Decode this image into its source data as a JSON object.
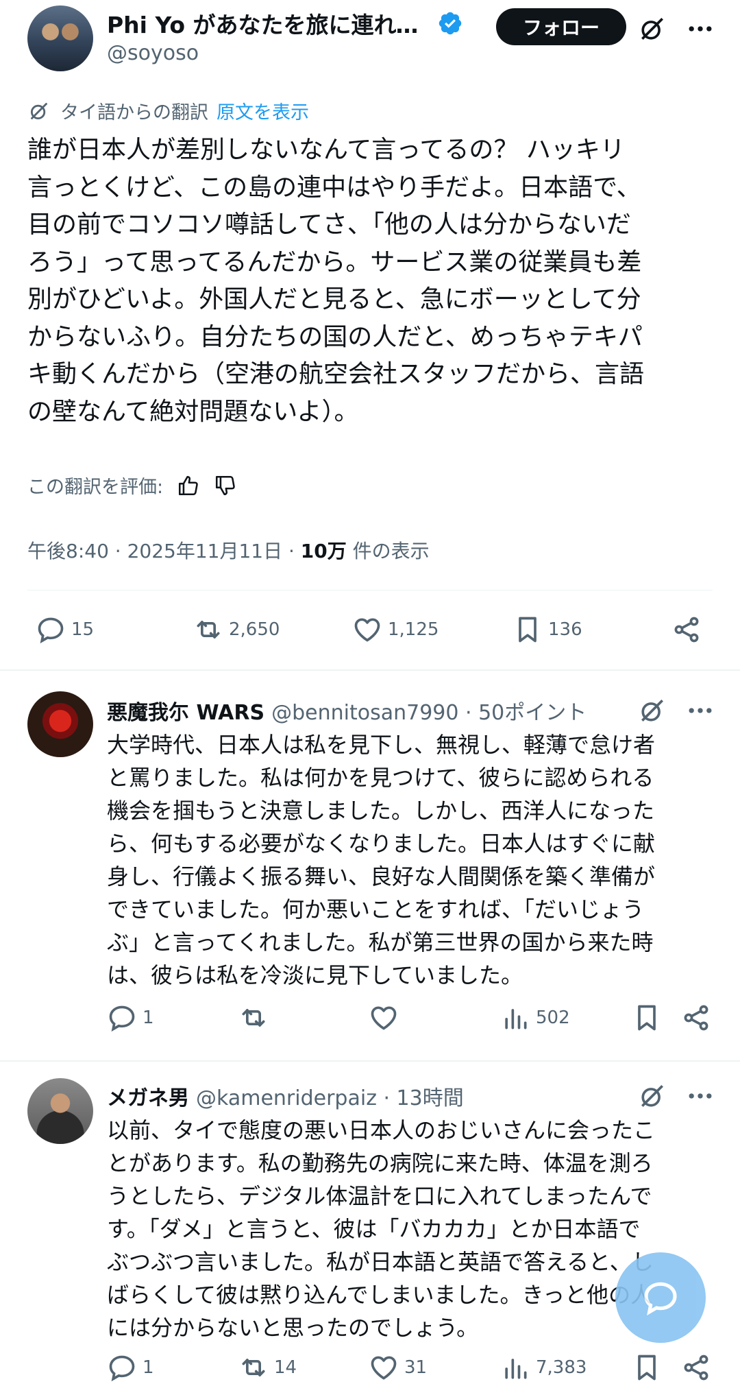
{
  "post": {
    "display_name": "Phi Yo があなたを旅に連れて…",
    "handle": "@soyoso",
    "follow_label": "フォロー",
    "translation_note": "タイ語からの翻訳",
    "show_original": "原文を表示",
    "body_lines": [
      "誰が日本人が差別しないなんて言ってるの？ ハッキリ",
      "言っとくけど、この島の連中はやり手だよ。日本語で、",
      "目の前でコソコソ噂話してさ、「他の人は分からないだ",
      "ろう」って思ってるんだから。サービス業の従業員も差",
      "別がひどいよ。外国人だと見ると、急にボーッとして分",
      "からないふり。自分たちの国の人だと、めっちゃテキパ",
      "キ動くんだから（空港の航空会社スタッフだから、言語",
      "の壁なんて絶対問題ないよ）。"
    ],
    "rate_label": "この翻訳を評価:",
    "time": "午後8:40 · 2025年11月11日 · ",
    "views_count": "10万",
    "views_label": " 件の表示",
    "replies": "15",
    "reposts": "2,650",
    "likes": "1,125",
    "bookmarks": "136"
  },
  "replies": [
    {
      "name": "悪魔我尓 WARS",
      "handle": "@bennitosan7990 · 50ポイント",
      "body_lines": [
        "大学時代、日本人は私を見下し、無視し、軽薄で怠け者",
        "と罵りました。私は何かを見つけて、彼らに認められる",
        "機会を掴もうと決意しました。しかし、西洋人になった",
        "ら、何もする必要がなくなりました。日本人はすぐに献",
        "身し、行儀よく振る舞い、良好な人間関係を築く準備が",
        "できていました。何か悪いことをすれば、「だいじょう",
        "ぶ」と言ってくれました。私が第三世界の国から来た時",
        "は、彼らは私を冷淡に見下していました。"
      ],
      "replies": "1",
      "reposts": "",
      "likes": "",
      "views": "502"
    },
    {
      "name": "メガネ男",
      "handle": "@kamenriderpaiz · 13時間",
      "body_lines": [
        "以前、タイで態度の悪い日本人のおじいさんに会ったこ",
        "とがあります。私の勤務先の病院に来た時、体温を測ろ",
        "うとしたら、デジタル体温計を口に入れてしまったんで",
        "す。「ダメ」と言うと、彼は「バカカカ」とか日本語で",
        "ぶつぶつ言いました。私が日本語と英語で答えると、し",
        "ばらくして彼は黙り込んでしまいました。きっと他の人",
        "には分からないと思ったのでしょう。"
      ],
      "replies": "1",
      "reposts": "14",
      "likes": "31",
      "views": "7,383"
    }
  ],
  "colors": {
    "text": "#0f1419",
    "muted": "#536471",
    "link": "#1d9bf0",
    "verified": "#1d9bf0",
    "fab": "#88c4f2"
  }
}
